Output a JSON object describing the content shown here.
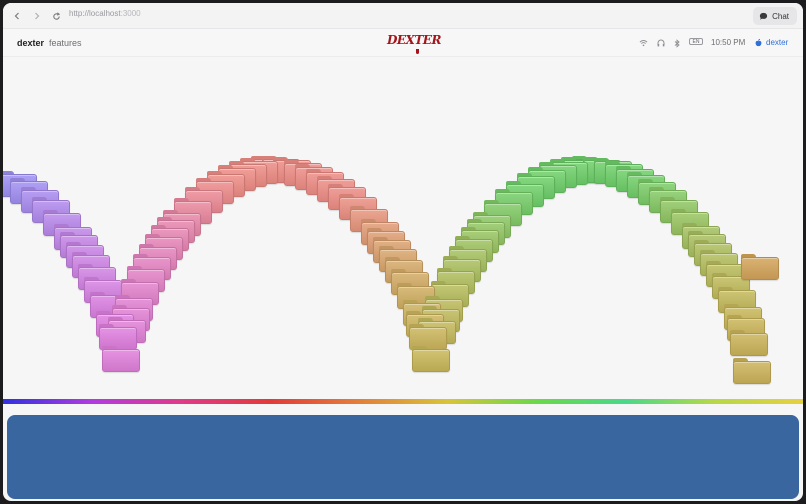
{
  "browser": {
    "back_icon": "chevron-left-icon",
    "forward_icon": "chevron-right-icon",
    "reload_icon": "reload-icon",
    "url_scheme": "http://",
    "url_host": "localhost",
    "url_port": ":3000",
    "chat_label": "Chat"
  },
  "menubar": {
    "brand": "dexter",
    "features_link": "features",
    "logo_text": "DEXTER",
    "battery_text": "EN",
    "clock": "10:50 PM",
    "user_name": "dexter"
  },
  "stage": {
    "colors": {
      "violet": "#9d90f4",
      "magenta": "#e07fe0",
      "salmon": "#ef8d86",
      "olive": "#c9b85a",
      "green": "#6fd06a",
      "tan": "#d4a45a"
    }
  },
  "footer": {
    "panel_color": "#3a66a0"
  }
}
